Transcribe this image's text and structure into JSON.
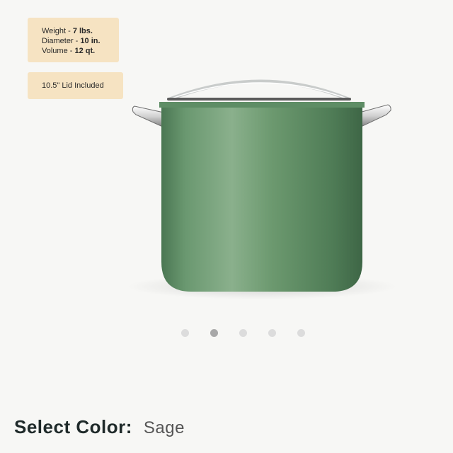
{
  "specs": {
    "weight_label": "Weight - ",
    "weight_value": "7 lbs.",
    "diameter_label": "Diameter - ",
    "diameter_value": "10 in.",
    "volume_label": "Volume - ",
    "volume_value": "12 qt."
  },
  "lid_badge": "10.5\" Lid Included",
  "product": {
    "image_icon": "stockpot-image",
    "color_hex": "#5c8a63"
  },
  "carousel": {
    "count": 5,
    "active_index": 1
  },
  "color_selector": {
    "label": "Select Color:",
    "value": "Sage"
  }
}
